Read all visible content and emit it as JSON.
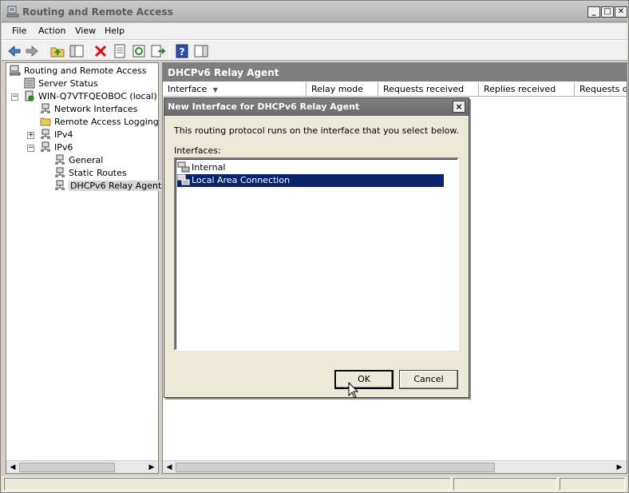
{
  "window": {
    "title": "Routing and Remote Access"
  },
  "menu": [
    "File",
    "Action",
    "View",
    "Help"
  ],
  "tree": {
    "items": [
      {
        "label": "Routing and Remote Access",
        "icon": "server-console-icon"
      },
      {
        "label": "Server Status",
        "icon": "server-status-icon"
      },
      {
        "label": "WIN-Q7VTFQEOBOC (local)",
        "icon": "server-icon",
        "expander": "−"
      },
      {
        "label": "Network Interfaces",
        "icon": "network-icon"
      },
      {
        "label": "Remote Access Logging & P",
        "icon": "folder-icon"
      },
      {
        "label": "IPv4",
        "icon": "network-icon",
        "expander": "+"
      },
      {
        "label": "IPv6",
        "icon": "network-icon",
        "expander": "−"
      },
      {
        "label": "General",
        "icon": "network-icon"
      },
      {
        "label": "Static Routes",
        "icon": "network-icon"
      },
      {
        "label": "DHCPv6 Relay Agent",
        "icon": "network-icon"
      }
    ]
  },
  "right": {
    "header": "DHCPv6 Relay Agent",
    "columns": [
      "Interface",
      "Relay mode",
      "Requests received",
      "Replies received",
      "Requests dis"
    ]
  },
  "dialog": {
    "title": "New Interface for DHCPv6 Relay Agent",
    "description": "This routing protocol runs on the interface that you select below.",
    "list_label": "Interfaces:",
    "interfaces": [
      "Internal",
      "Local Area Connection"
    ],
    "selected": "Local Area Connection",
    "ok_label": "OK",
    "cancel_label": "Cancel",
    "close_symbol": "×"
  },
  "colors": {
    "selection": "#0a246a",
    "header_bg": "#7e7e7e"
  }
}
